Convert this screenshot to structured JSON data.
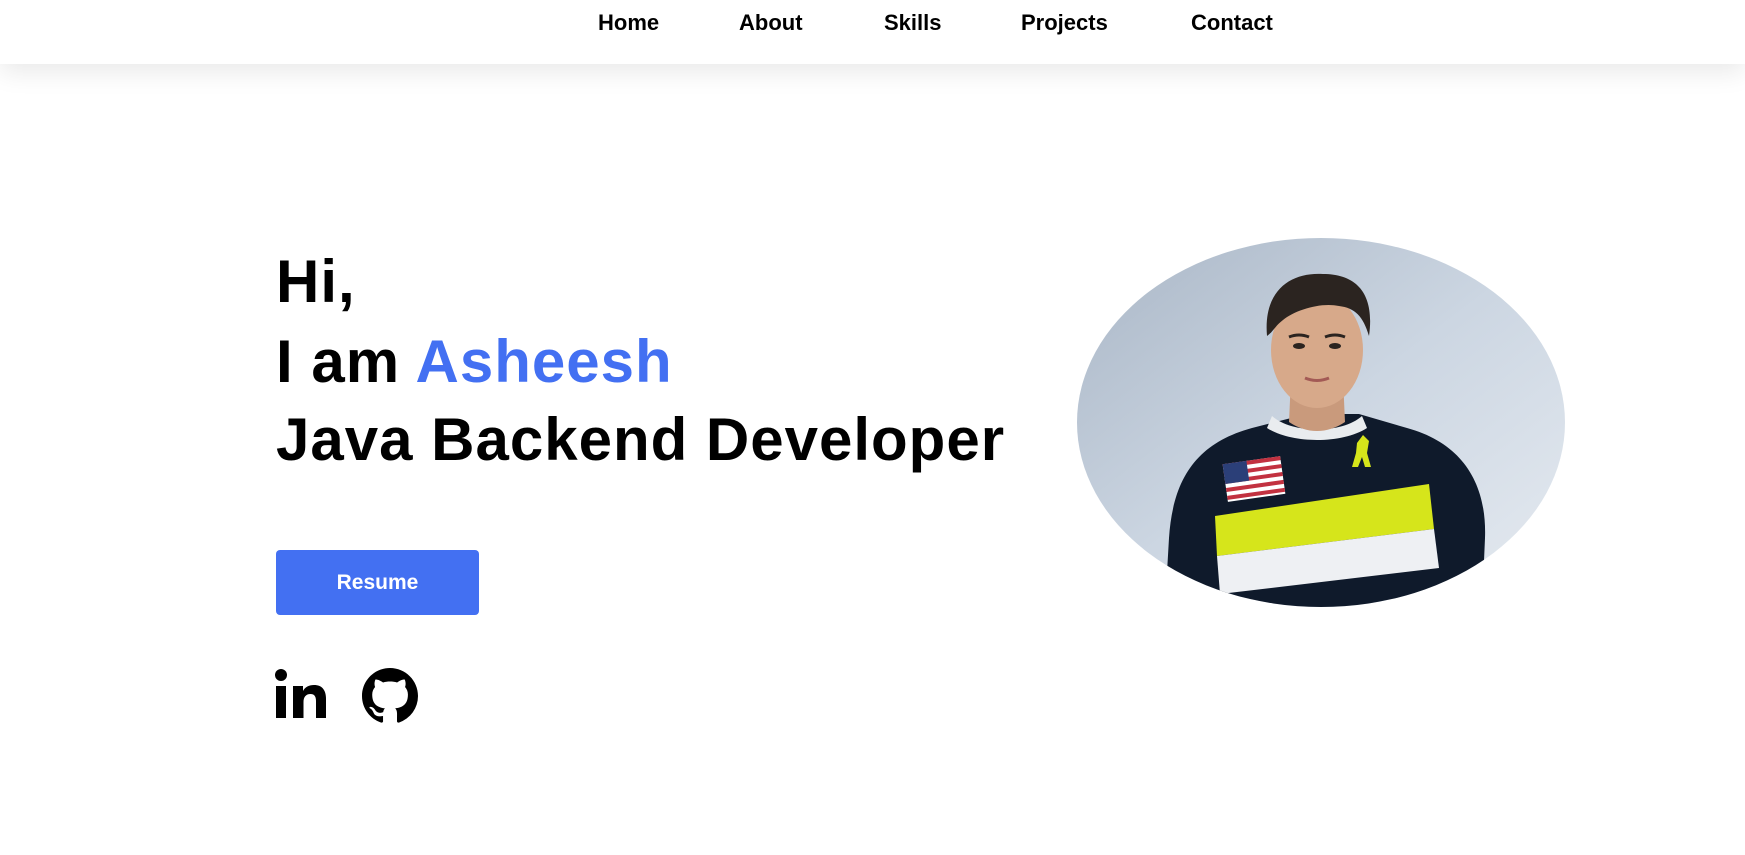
{
  "nav": {
    "items": [
      {
        "label": "Home"
      },
      {
        "label": "About"
      },
      {
        "label": "Skills"
      },
      {
        "label": "Projects"
      },
      {
        "label": "Contact"
      }
    ]
  },
  "hero": {
    "greeting": "Hi,",
    "intro_prefix": "I am ",
    "name": "Asheesh",
    "role": "Java Backend Developer",
    "resume_label": "Resume"
  },
  "social": {
    "links": [
      {
        "icon": "linkedin-icon",
        "label": "in"
      },
      {
        "icon": "github-icon"
      }
    ]
  },
  "colors": {
    "accent": "#4370f2",
    "text": "#000000",
    "background": "#ffffff"
  },
  "profile_photo": {
    "subject": "profile-photo"
  }
}
